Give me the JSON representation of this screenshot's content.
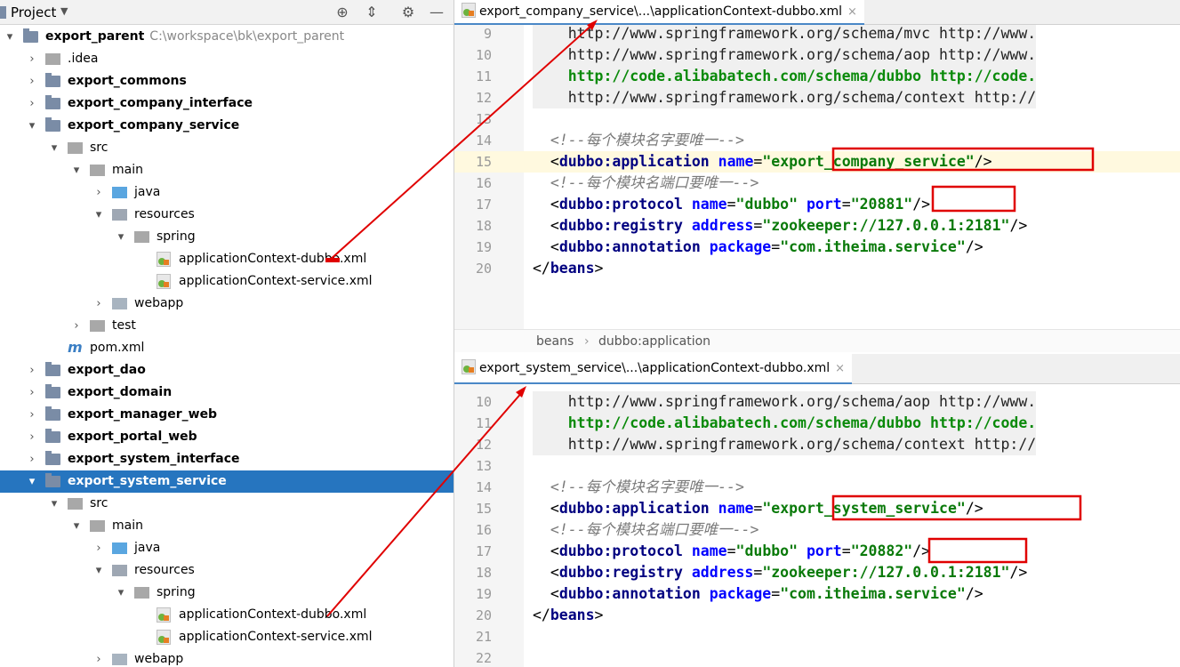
{
  "project_panel": {
    "title": "Project",
    "toolbar_icons": [
      "locate-icon",
      "collapse-icon",
      "gear-icon",
      "minimize-icon"
    ]
  },
  "tree": [
    {
      "indent": 0,
      "arrow": "▾",
      "icon": "module",
      "label": "export_parent",
      "bold": true,
      "path": "C:\\workspace\\bk\\export_parent"
    },
    {
      "indent": 1,
      "arrow": "›",
      "icon": "folder",
      "label": ".idea",
      "bold": false
    },
    {
      "indent": 1,
      "arrow": "›",
      "icon": "module",
      "label": "export_commons",
      "bold": true
    },
    {
      "indent": 1,
      "arrow": "›",
      "icon": "module",
      "label": "export_company_interface",
      "bold": true
    },
    {
      "indent": 1,
      "arrow": "▾",
      "icon": "module",
      "label": "export_company_service",
      "bold": true
    },
    {
      "indent": 2,
      "arrow": "▾",
      "icon": "folder",
      "label": "src",
      "bold": false
    },
    {
      "indent": 3,
      "arrow": "▾",
      "icon": "folder",
      "label": "main",
      "bold": false
    },
    {
      "indent": 4,
      "arrow": "›",
      "icon": "folder-blue",
      "label": "java",
      "bold": false
    },
    {
      "indent": 4,
      "arrow": "▾",
      "icon": "folder-res",
      "label": "resources",
      "bold": false
    },
    {
      "indent": 5,
      "arrow": "▾",
      "icon": "folder",
      "label": "spring",
      "bold": false
    },
    {
      "indent": 6,
      "arrow": "",
      "icon": "xml",
      "label": "applicationContext-dubbo.xml",
      "bold": false
    },
    {
      "indent": 6,
      "arrow": "",
      "icon": "xml",
      "label": "applicationContext-service.xml",
      "bold": false
    },
    {
      "indent": 4,
      "arrow": "›",
      "icon": "folder-web",
      "label": "webapp",
      "bold": false
    },
    {
      "indent": 3,
      "arrow": "›",
      "icon": "folder",
      "label": "test",
      "bold": false
    },
    {
      "indent": 2,
      "arrow": "",
      "icon": "pom",
      "label": "pom.xml",
      "bold": false
    },
    {
      "indent": 1,
      "arrow": "›",
      "icon": "module",
      "label": "export_dao",
      "bold": true
    },
    {
      "indent": 1,
      "arrow": "›",
      "icon": "module",
      "label": "export_domain",
      "bold": true
    },
    {
      "indent": 1,
      "arrow": "›",
      "icon": "module",
      "label": "export_manager_web",
      "bold": true
    },
    {
      "indent": 1,
      "arrow": "›",
      "icon": "module",
      "label": "export_portal_web",
      "bold": true
    },
    {
      "indent": 1,
      "arrow": "›",
      "icon": "module",
      "label": "export_system_interface",
      "bold": true
    },
    {
      "indent": 1,
      "arrow": "▾",
      "icon": "module",
      "label": "export_system_service",
      "bold": true,
      "selected": true
    },
    {
      "indent": 2,
      "arrow": "▾",
      "icon": "folder",
      "label": "src",
      "bold": false
    },
    {
      "indent": 3,
      "arrow": "▾",
      "icon": "folder",
      "label": "main",
      "bold": false
    },
    {
      "indent": 4,
      "arrow": "›",
      "icon": "folder-blue",
      "label": "java",
      "bold": false
    },
    {
      "indent": 4,
      "arrow": "▾",
      "icon": "folder-res",
      "label": "resources",
      "bold": false
    },
    {
      "indent": 5,
      "arrow": "▾",
      "icon": "folder",
      "label": "spring",
      "bold": false
    },
    {
      "indent": 6,
      "arrow": "",
      "icon": "xml",
      "label": "applicationContext-dubbo.xml",
      "bold": false
    },
    {
      "indent": 6,
      "arrow": "",
      "icon": "xml",
      "label": "applicationContext-service.xml",
      "bold": false
    },
    {
      "indent": 4,
      "arrow": "›",
      "icon": "folder-web",
      "label": "webapp",
      "bold": false
    }
  ],
  "editor_top": {
    "tab_label": "export_company_service\\...\\applicationContext-dubbo.xml",
    "tab_close": "×",
    "breadcrumb": [
      "beans",
      "dubbo:application"
    ],
    "lines": [
      {
        "n": "9",
        "parts": [
          [
            "c-url",
            "    http://www.springframework.org/schema/mvc http://www."
          ]
        ],
        "gray": true
      },
      {
        "n": "10",
        "parts": [
          [
            "c-url",
            "    http://www.springframework.org/schema/aop http://www."
          ]
        ],
        "gray": true
      },
      {
        "n": "11",
        "parts": [
          [
            "c-grn",
            "    http://code.alibabatech.com/schema/dubbo http://code."
          ]
        ],
        "gray": true
      },
      {
        "n": "12",
        "parts": [
          [
            "c-url",
            "    http://www.springframework.org/schema/context http://"
          ]
        ],
        "gray": true
      },
      {
        "n": "13",
        "parts": []
      },
      {
        "n": "14",
        "parts": [
          [
            "c-cmt",
            "  <!--每个模块名字要唯一-->"
          ]
        ]
      },
      {
        "n": "15",
        "hl": true,
        "parts": [
          [
            "c-pun",
            "  <"
          ],
          [
            "c-tag",
            "dubbo:application"
          ],
          [
            "c-pun",
            " "
          ],
          [
            "c-attr",
            "name"
          ],
          [
            "c-pun",
            "="
          ],
          [
            "c-val",
            "\"export_company_service\""
          ],
          [
            "c-pun",
            "/>"
          ]
        ]
      },
      {
        "n": "16",
        "parts": [
          [
            "c-cmt",
            "  <!--每个模块名端口要唯一-->"
          ]
        ]
      },
      {
        "n": "17",
        "parts": [
          [
            "c-pun",
            "  <"
          ],
          [
            "c-tag",
            "dubbo:protocol"
          ],
          [
            "c-pun",
            " "
          ],
          [
            "c-attr",
            "name"
          ],
          [
            "c-pun",
            "="
          ],
          [
            "c-val",
            "\"dubbo\""
          ],
          [
            "c-pun",
            " "
          ],
          [
            "c-attr",
            "port"
          ],
          [
            "c-pun",
            "="
          ],
          [
            "c-val",
            "\"20881\""
          ],
          [
            "c-pun",
            "/>"
          ]
        ]
      },
      {
        "n": "18",
        "parts": [
          [
            "c-pun",
            "  <"
          ],
          [
            "c-tag",
            "dubbo:registry"
          ],
          [
            "c-pun",
            " "
          ],
          [
            "c-attr",
            "address"
          ],
          [
            "c-pun",
            "="
          ],
          [
            "c-val",
            "\"zookeeper://127.0.0.1:2181\""
          ],
          [
            "c-pun",
            "/>"
          ]
        ]
      },
      {
        "n": "19",
        "parts": [
          [
            "c-pun",
            "  <"
          ],
          [
            "c-tag",
            "dubbo:annotation"
          ],
          [
            "c-pun",
            " "
          ],
          [
            "c-attr",
            "package"
          ],
          [
            "c-pun",
            "="
          ],
          [
            "c-val",
            "\"com.itheima.service\""
          ],
          [
            "c-pun",
            "/>"
          ]
        ]
      },
      {
        "n": "20",
        "parts": [
          [
            "c-pun",
            "</"
          ],
          [
            "c-tag",
            "beans"
          ],
          [
            "c-pun",
            ">"
          ]
        ]
      }
    ]
  },
  "editor_bottom": {
    "tab_label": "export_system_service\\...\\applicationContext-dubbo.xml",
    "tab_close": "×",
    "lines": [
      {
        "n": "10",
        "parts": [
          [
            "c-url",
            "    http://www.springframework.org/schema/aop http://www."
          ]
        ],
        "gray": true
      },
      {
        "n": "11",
        "parts": [
          [
            "c-grn",
            "    http://code.alibabatech.com/schema/dubbo http://code."
          ]
        ],
        "gray": true
      },
      {
        "n": "12",
        "parts": [
          [
            "c-url",
            "    http://www.springframework.org/schema/context http://"
          ]
        ],
        "gray": true
      },
      {
        "n": "13",
        "parts": []
      },
      {
        "n": "14",
        "parts": [
          [
            "c-cmt",
            "  <!--每个模块名字要唯一-->"
          ]
        ]
      },
      {
        "n": "15",
        "parts": [
          [
            "c-pun",
            "  <"
          ],
          [
            "c-tag",
            "dubbo:application"
          ],
          [
            "c-pun",
            " "
          ],
          [
            "c-attr",
            "name"
          ],
          [
            "c-pun",
            "="
          ],
          [
            "c-val",
            "\"export_system_service\""
          ],
          [
            "c-pun",
            "/>"
          ]
        ]
      },
      {
        "n": "16",
        "parts": [
          [
            "c-cmt",
            "  <!--每个模块名端口要唯一-->"
          ]
        ]
      },
      {
        "n": "17",
        "parts": [
          [
            "c-pun",
            "  <"
          ],
          [
            "c-tag",
            "dubbo:protocol"
          ],
          [
            "c-pun",
            " "
          ],
          [
            "c-attr",
            "name"
          ],
          [
            "c-pun",
            "="
          ],
          [
            "c-val",
            "\"dubbo\""
          ],
          [
            "c-pun",
            " "
          ],
          [
            "c-attr",
            "port"
          ],
          [
            "c-pun",
            "="
          ],
          [
            "c-val",
            "\"20882\""
          ],
          [
            "c-pun",
            "/>"
          ]
        ]
      },
      {
        "n": "18",
        "parts": [
          [
            "c-pun",
            "  <"
          ],
          [
            "c-tag",
            "dubbo:registry"
          ],
          [
            "c-pun",
            " "
          ],
          [
            "c-attr",
            "address"
          ],
          [
            "c-pun",
            "="
          ],
          [
            "c-val",
            "\"zookeeper://127.0.0.1:2181\""
          ],
          [
            "c-pun",
            "/>"
          ]
        ]
      },
      {
        "n": "19",
        "parts": [
          [
            "c-pun",
            "  <"
          ],
          [
            "c-tag",
            "dubbo:annotation"
          ],
          [
            "c-pun",
            " "
          ],
          [
            "c-attr",
            "package"
          ],
          [
            "c-pun",
            "="
          ],
          [
            "c-val",
            "\"com.itheima.service\""
          ],
          [
            "c-pun",
            "/>"
          ]
        ]
      },
      {
        "n": "20",
        "parts": [
          [
            "c-pun",
            "</"
          ],
          [
            "c-tag",
            "beans"
          ],
          [
            "c-pun",
            ">"
          ]
        ]
      },
      {
        "n": "21",
        "parts": []
      },
      {
        "n": "22",
        "parts": []
      }
    ]
  },
  "colors": {
    "selection": "#2675bf",
    "annotation": "#e00000"
  }
}
